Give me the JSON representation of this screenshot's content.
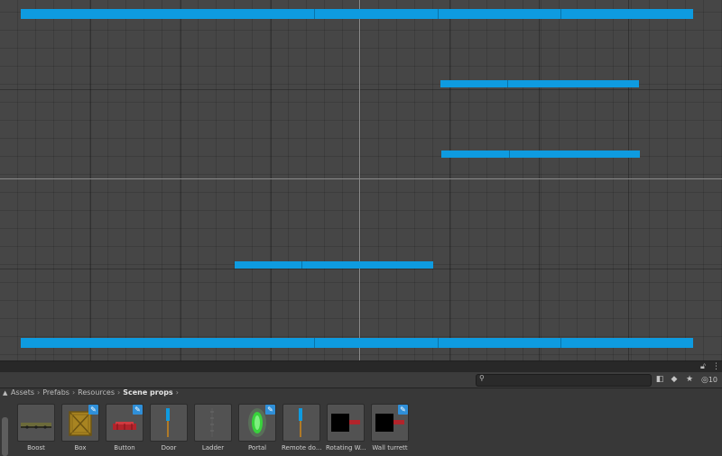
{
  "colors": {
    "scene_background": "#464646",
    "platform_blue": "#0e9be0",
    "panel_background": "#383838",
    "edit_badge_blue": "#2f8fd8"
  },
  "scene": {
    "platforms": [
      "platform",
      "platform",
      "platform",
      "platform",
      "platform"
    ]
  },
  "panel": {
    "lock_icon": "lock-icon",
    "menu_icon": "kebab-menu-icon",
    "search": {
      "value": "",
      "placeholder": ""
    },
    "toolbar": {
      "filter_type_icon": "filter-by-type-icon",
      "filter_label_icon": "filter-by-label-icon",
      "favorite_icon": "star-icon",
      "hidden_packages_icon": "eye-slash-icon",
      "hidden_packages_count": "10"
    },
    "breadcrumb": [
      "Assets",
      "Prefabs",
      "Resources",
      "Scene props"
    ],
    "breadcrumb_separator": "›",
    "assets": [
      {
        "name": "Boost",
        "icon": "boost-pad-icon",
        "badge": false
      },
      {
        "name": "Box",
        "icon": "wooden-crate-icon",
        "badge": true
      },
      {
        "name": "Button",
        "icon": "red-button-icon",
        "badge": true
      },
      {
        "name": "Door",
        "icon": "door-icon",
        "badge": false
      },
      {
        "name": "Ladder",
        "icon": "ladder-icon",
        "badge": false
      },
      {
        "name": "Portal",
        "icon": "green-portal-icon",
        "badge": true
      },
      {
        "name": "Remote do...",
        "icon": "remote-door-icon",
        "badge": false
      },
      {
        "name": "Rotating W...",
        "icon": "rotating-wall-turret-icon",
        "badge": false
      },
      {
        "name": "Wall turrett",
        "icon": "wall-turret-icon",
        "badge": true
      }
    ]
  }
}
